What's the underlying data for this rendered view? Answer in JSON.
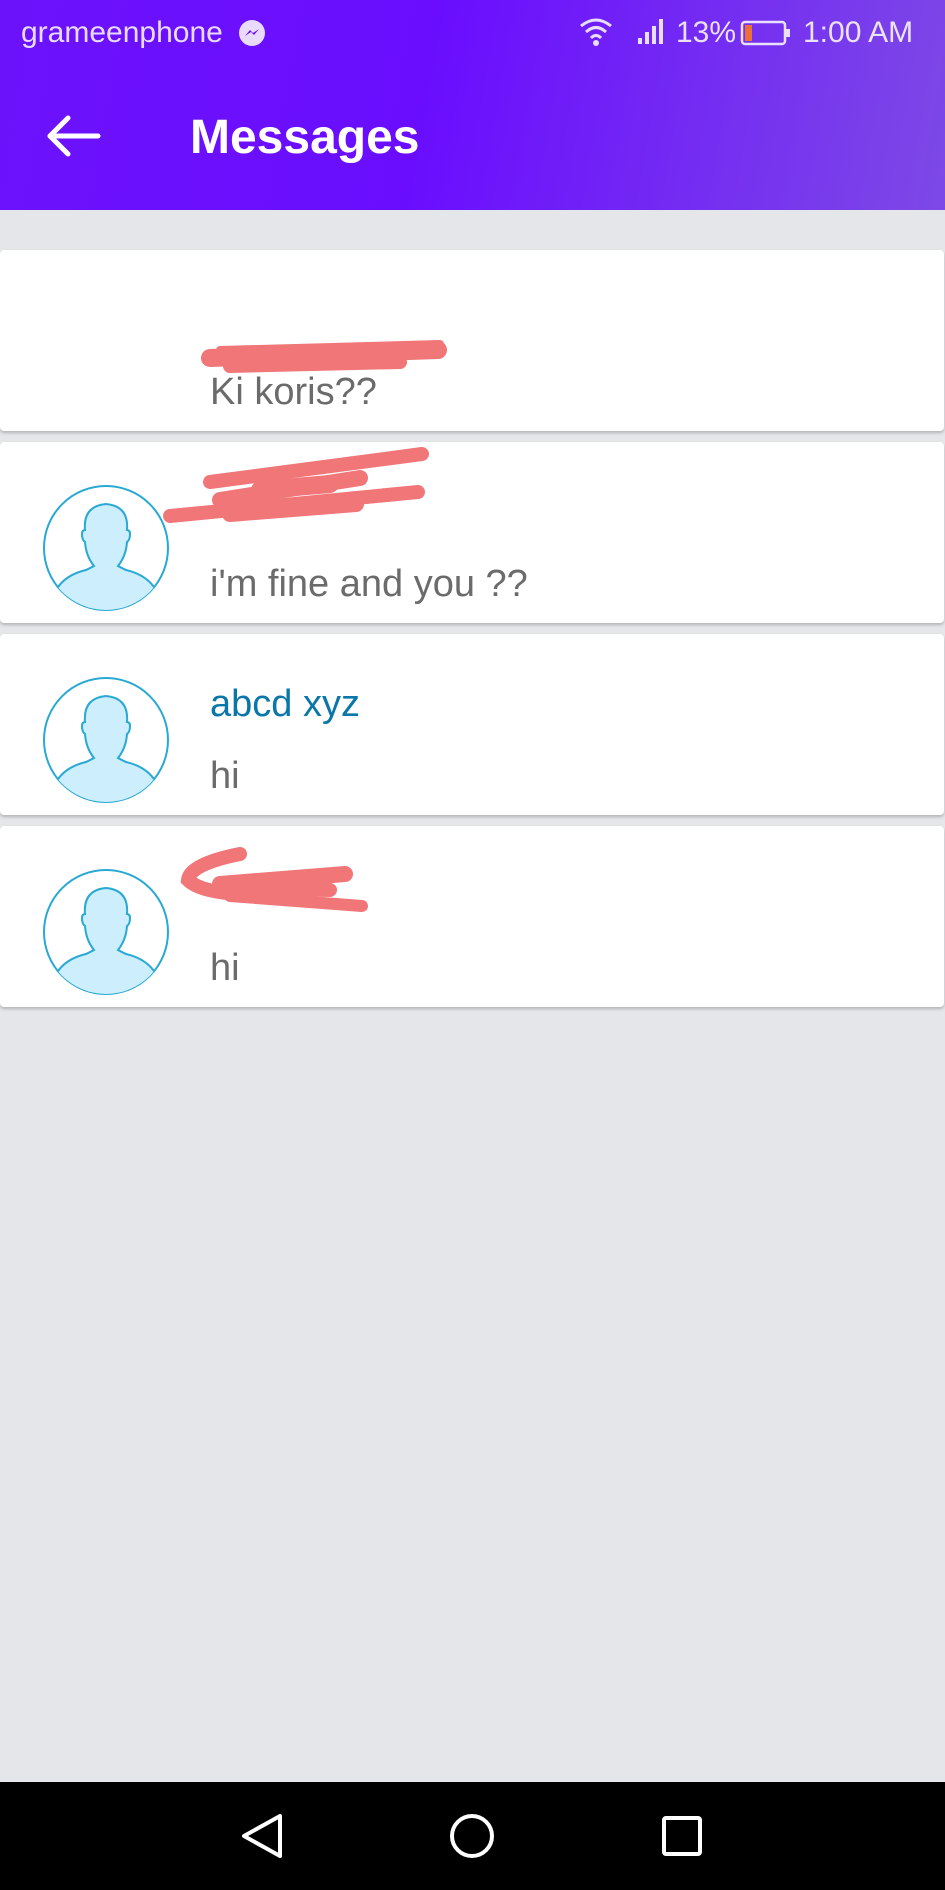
{
  "status_bar": {
    "carrier": "grameenphone",
    "battery_percent": "13%",
    "time": "1:00 AM",
    "icons": [
      "messenger-icon",
      "wifi-icon",
      "signal-icon",
      "battery-icon"
    ]
  },
  "header": {
    "title": "Messages",
    "back_icon": "arrow-left-icon"
  },
  "conversations": [
    {
      "name": "",
      "preview": "Ki koris??",
      "name_redacted": true,
      "avatar_shown": false
    },
    {
      "name": "",
      "preview": "i'm fine and you ??",
      "name_redacted": true,
      "avatar_shown": true
    },
    {
      "name": "abcd xyz",
      "preview": "hi",
      "name_redacted": false,
      "avatar_shown": true
    },
    {
      "name": "",
      "preview": "hi",
      "name_redacted": true,
      "avatar_shown": true
    }
  ],
  "nav_bar": {
    "icons": [
      "back-triangle-icon",
      "home-circle-icon",
      "recents-square-icon"
    ]
  },
  "colors": {
    "header_gradient_start": "#6c12fb",
    "header_gradient_end": "#7d49e6",
    "name_text": "#0b76a9",
    "preview_text": "#6b6b6b",
    "redaction": "#f07678",
    "avatar_fill": "#cdeefc",
    "avatar_stroke": "#29a9d4",
    "list_background": "#e5e6e9"
  }
}
